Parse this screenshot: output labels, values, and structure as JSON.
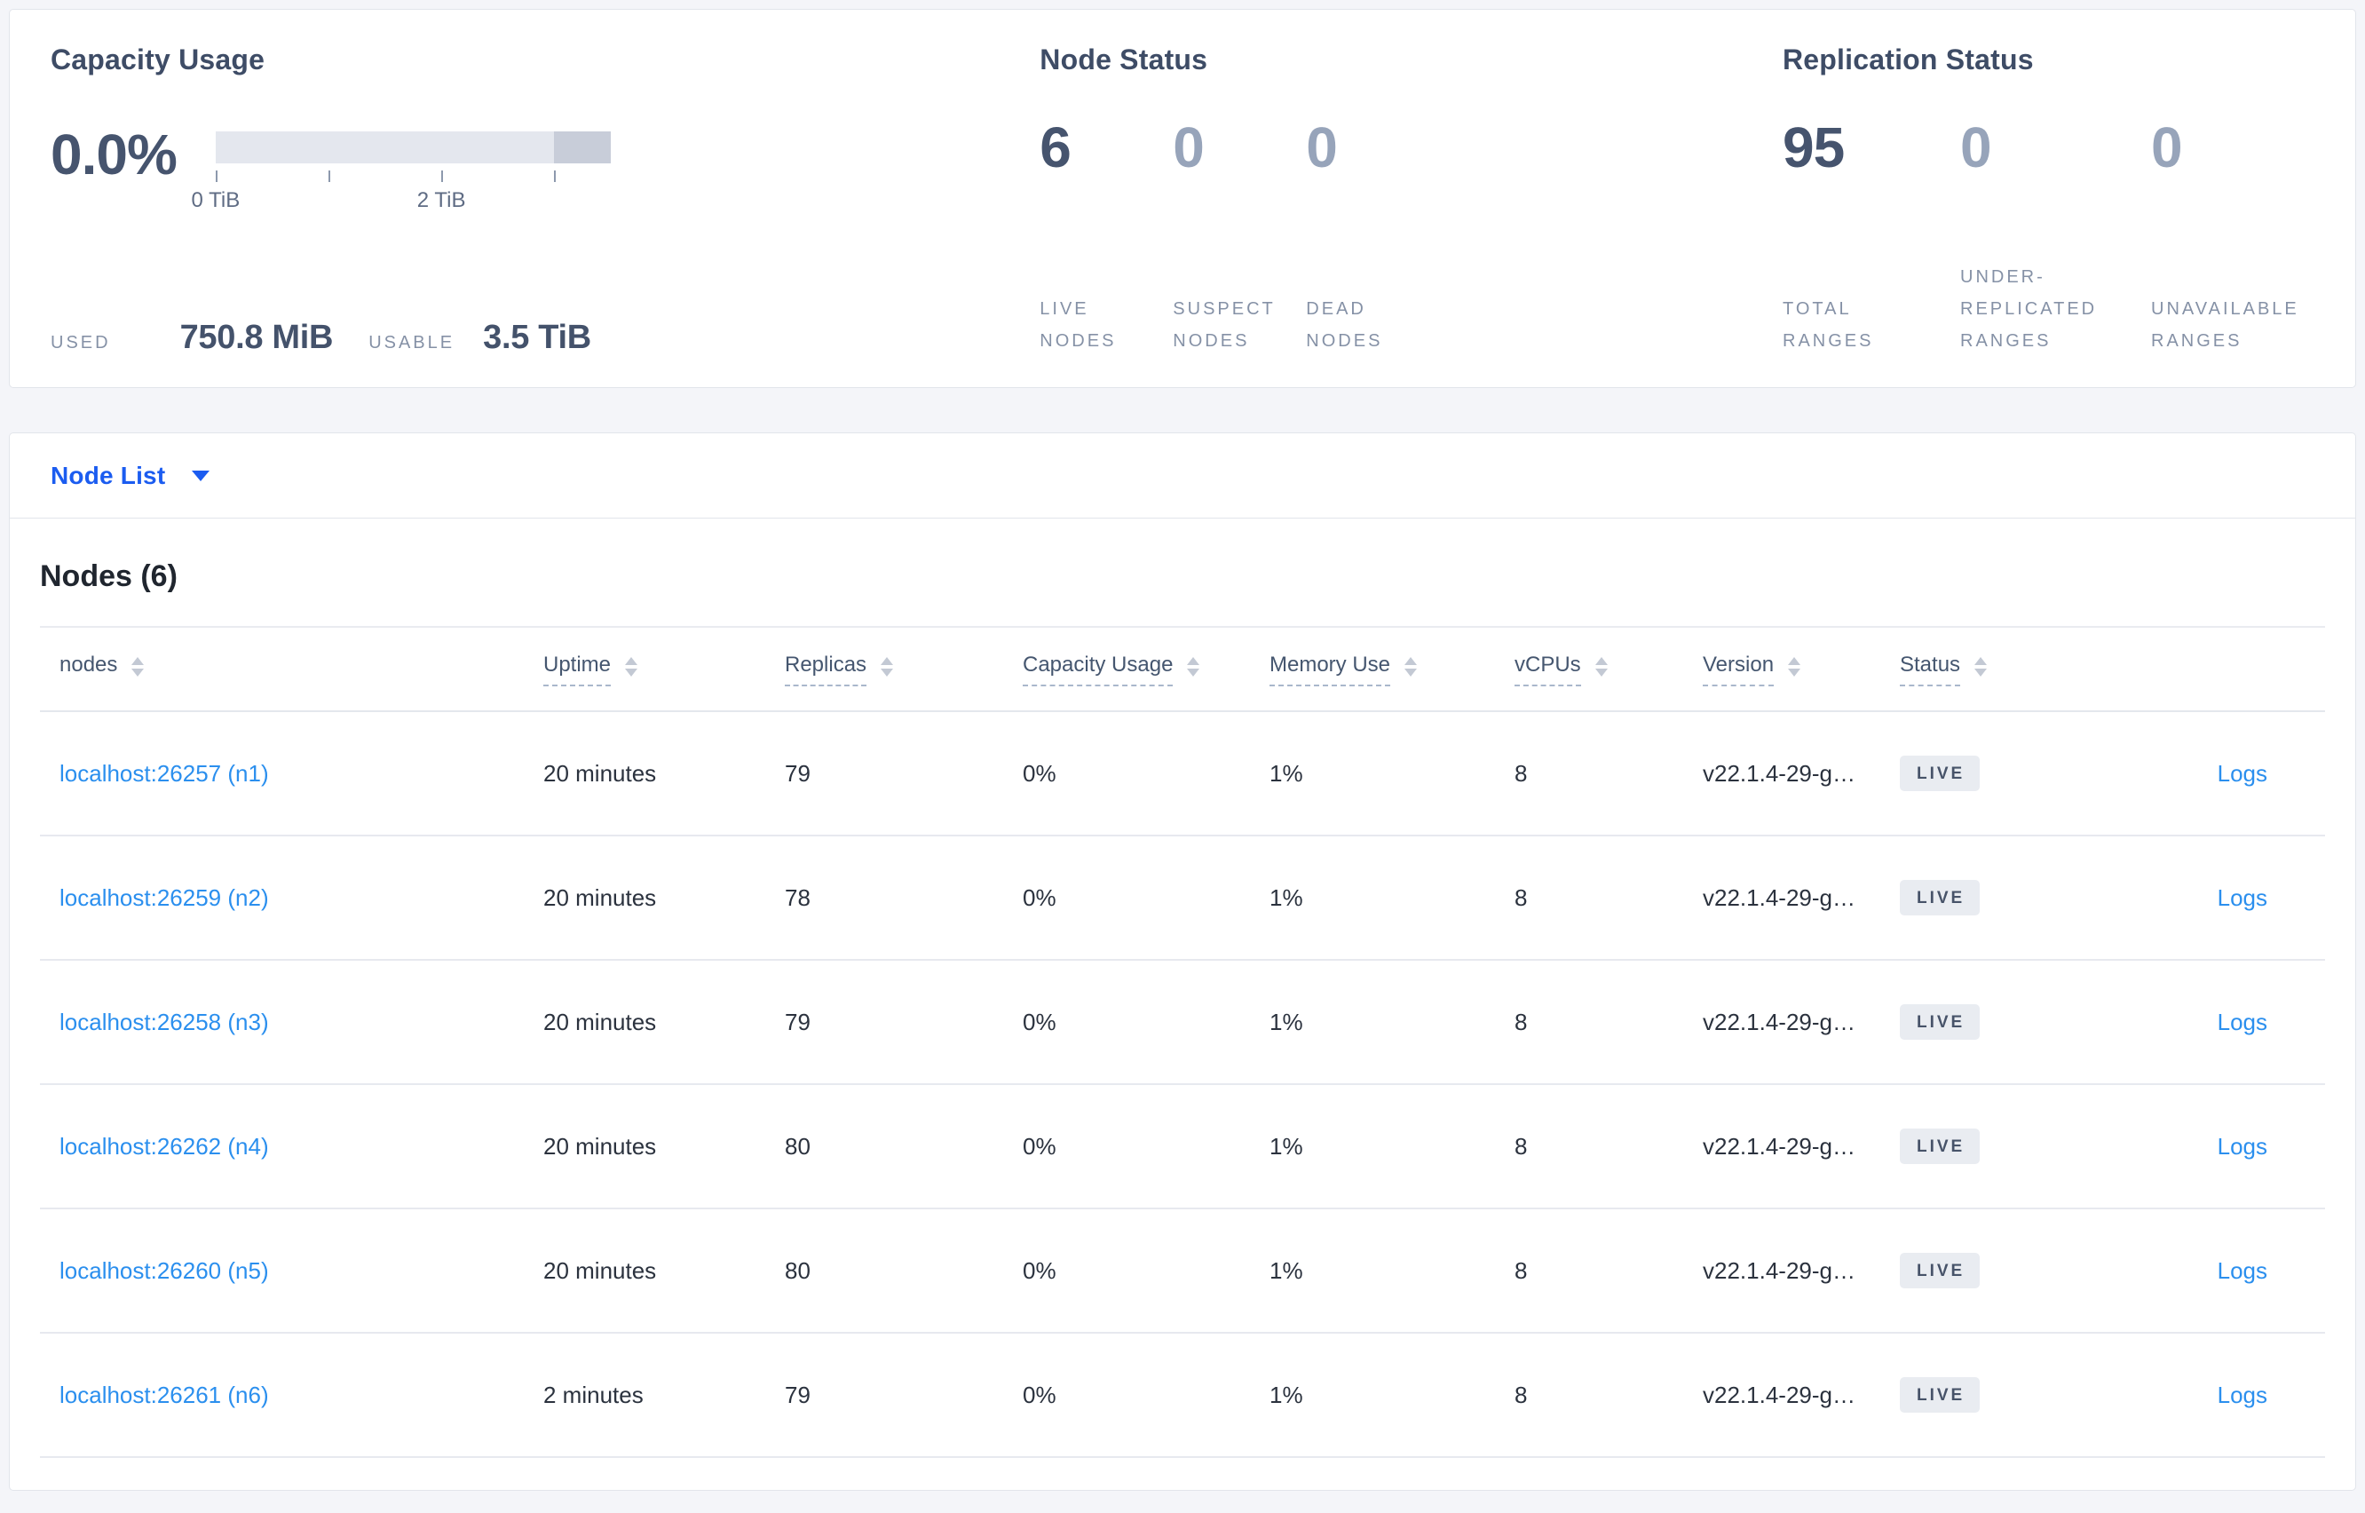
{
  "summary": {
    "capacity": {
      "title": "Capacity Usage",
      "percent_used": "0.0%",
      "gauge": {
        "total": "3.5 TiB",
        "tick_positions_pct": [
          0,
          28.57,
          57.14,
          85.71
        ],
        "tick_labels": [
          {
            "text": "0 TiB",
            "position_pct": 0
          },
          {
            "text": "2 TiB",
            "position_pct": 57.14
          }
        ],
        "dark_segment_start_pct": 85.71
      },
      "used_label": "USED",
      "used_value": "750.8 MiB",
      "usable_label": "USABLE",
      "usable_value": "3.5 TiB"
    },
    "node_status": {
      "title": "Node Status",
      "stats": [
        {
          "value": "6",
          "emphasis": true,
          "lines": [
            "LIVE",
            "NODES"
          ]
        },
        {
          "value": "0",
          "emphasis": false,
          "lines": [
            "SUSPECT",
            "NODES"
          ]
        },
        {
          "value": "0",
          "emphasis": false,
          "lines": [
            "DEAD",
            "NODES"
          ]
        }
      ]
    },
    "replication": {
      "title": "Replication Status",
      "stats": [
        {
          "value": "95",
          "emphasis": true,
          "lines": [
            "TOTAL",
            "RANGES"
          ]
        },
        {
          "value": "0",
          "emphasis": false,
          "lines": [
            "UNDER-",
            "REPLICATED",
            "RANGES"
          ]
        },
        {
          "value": "0",
          "emphasis": false,
          "lines": [
            "UNAVAILABLE",
            "RANGES"
          ]
        }
      ]
    }
  },
  "view_selector": {
    "label": "Node List"
  },
  "table": {
    "title": "Nodes (6)",
    "columns": [
      {
        "label": "nodes",
        "underlined": false
      },
      {
        "label": "Uptime",
        "underlined": true
      },
      {
        "label": "Replicas",
        "underlined": true
      },
      {
        "label": "Capacity Usage",
        "underlined": true
      },
      {
        "label": "Memory Use",
        "underlined": true
      },
      {
        "label": "vCPUs",
        "underlined": true
      },
      {
        "label": "Version",
        "underlined": true
      },
      {
        "label": "Status",
        "underlined": true
      }
    ],
    "rows": [
      {
        "node": "localhost:26257 (n1)",
        "uptime": "20 minutes",
        "replicas": "79",
        "capacity_usage": "0%",
        "memory_use": "1%",
        "vcpus": "8",
        "version": "v22.1.4-29-g…",
        "status": "LIVE",
        "logs": "Logs"
      },
      {
        "node": "localhost:26259 (n2)",
        "uptime": "20 minutes",
        "replicas": "78",
        "capacity_usage": "0%",
        "memory_use": "1%",
        "vcpus": "8",
        "version": "v22.1.4-29-g…",
        "status": "LIVE",
        "logs": "Logs"
      },
      {
        "node": "localhost:26258 (n3)",
        "uptime": "20 minutes",
        "replicas": "79",
        "capacity_usage": "0%",
        "memory_use": "1%",
        "vcpus": "8",
        "version": "v22.1.4-29-g…",
        "status": "LIVE",
        "logs": "Logs"
      },
      {
        "node": "localhost:26262 (n4)",
        "uptime": "20 minutes",
        "replicas": "80",
        "capacity_usage": "0%",
        "memory_use": "1%",
        "vcpus": "8",
        "version": "v22.1.4-29-g…",
        "status": "LIVE",
        "logs": "Logs"
      },
      {
        "node": "localhost:26260 (n5)",
        "uptime": "20 minutes",
        "replicas": "80",
        "capacity_usage": "0%",
        "memory_use": "1%",
        "vcpus": "8",
        "version": "v22.1.4-29-g…",
        "status": "LIVE",
        "logs": "Logs"
      },
      {
        "node": "localhost:26261 (n6)",
        "uptime": "2 minutes",
        "replicas": "79",
        "capacity_usage": "0%",
        "memory_use": "1%",
        "vcpus": "8",
        "version": "v22.1.4-29-g…",
        "status": "LIVE",
        "logs": "Logs"
      }
    ]
  },
  "colors": {
    "page_background": "#f4f5f9",
    "card_border": "#e2e5eb",
    "panel_title": "#3e4c66",
    "stat_emphasis": "#46546e",
    "stat_muted": "#97a4ba",
    "stat_label": "#8591a6",
    "selector_blue": "#1b5cf0",
    "link_blue": "#2b8fee",
    "badge_background": "#e9ecf1",
    "badge_text": "#475369",
    "gauge_bar": "#e4e7ee",
    "gauge_bar_dark": "#c8cdd9"
  }
}
